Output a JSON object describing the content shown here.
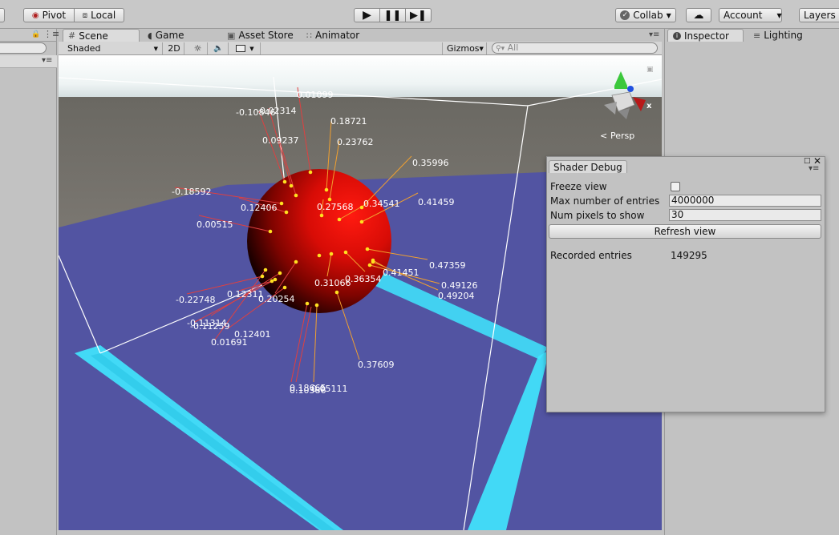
{
  "toolbar": {
    "pivot_label": "Pivot",
    "local_label": "Local",
    "collab_label": "Collab",
    "account_label": "Account",
    "layers_label": "Layers"
  },
  "scene_tabs": {
    "scene": "Scene",
    "game": "Game",
    "asset_store": "Asset Store",
    "animator": "Animator"
  },
  "scene_bar": {
    "shading_mode": "Shaded",
    "mode_2d": "2D",
    "gizmos_label": "Gizmos",
    "search_placeholder": "All"
  },
  "viewport": {
    "persp_label": "Persp",
    "debug_values": [
      "0.01099",
      "-0.10846",
      "-0.02314",
      "0.18721",
      "0.09237",
      "0.23762",
      "0.35996",
      "-0.18592",
      "0.12406",
      "0.27568",
      "0.34541",
      "0.41459",
      "0.00515",
      "0.47359",
      "0.41451",
      "0.31066",
      "0.36354",
      "0.49126",
      "0.49204",
      "-0.22748",
      "0.12311",
      "0.20254",
      "-0.11314",
      "-0.11259",
      "0.12401",
      "0.01691",
      "0.37609",
      "0.18665",
      "0.10386",
      "0.05111"
    ]
  },
  "inspector": {
    "inspector_tab": "Inspector",
    "lighting_tab": "Lighting"
  },
  "shader_debug": {
    "title": "Shader Debug",
    "freeze_view_label": "Freeze view",
    "max_entries_label": "Max number of entries",
    "max_entries_value": "4000000",
    "num_pixels_label": "Num pixels to show",
    "num_pixels_value": "30",
    "refresh_label": "Refresh view",
    "recorded_label": "Recorded entries",
    "recorded_value": "149295"
  }
}
